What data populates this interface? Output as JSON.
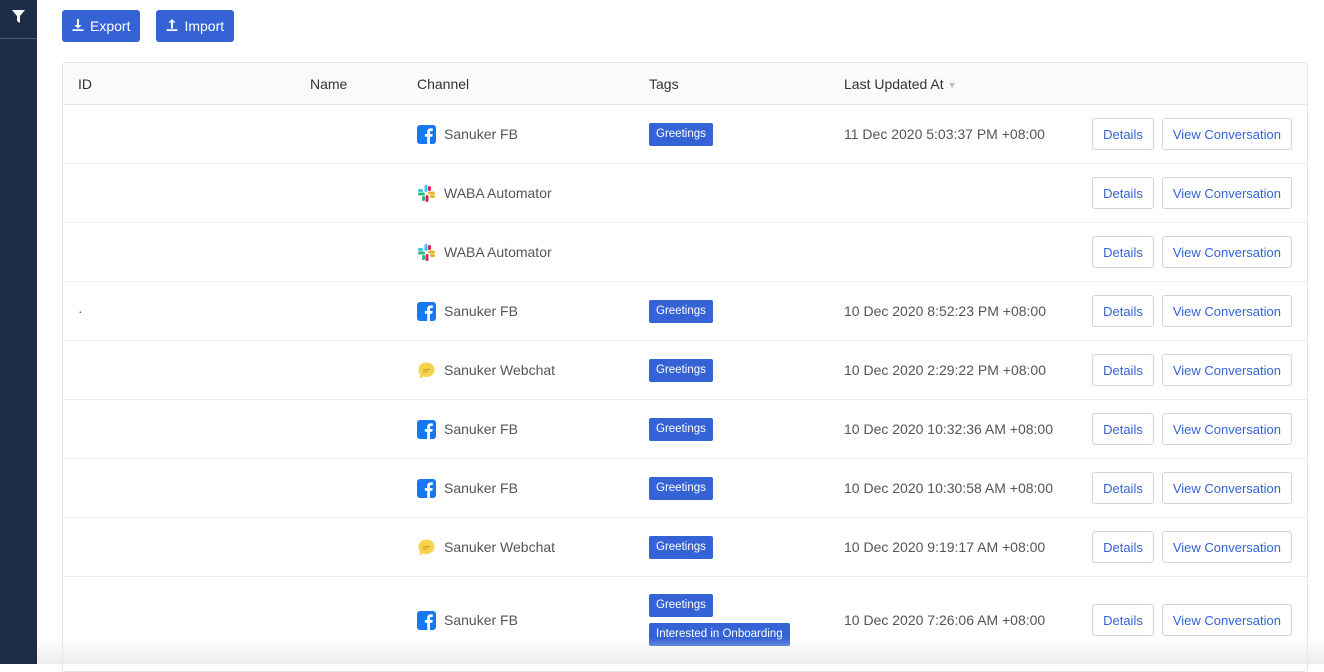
{
  "toolbar": {
    "export_label": "Export",
    "import_label": "Import"
  },
  "table": {
    "columns": {
      "id": "ID",
      "name": "Name",
      "channel": "Channel",
      "tags": "Tags",
      "updated": "Last Updated At"
    },
    "rows": [
      {
        "id": "",
        "name": "",
        "channel": "Sanuker FB",
        "channel_icon": "facebook-icon",
        "tags": [
          "Greetings"
        ],
        "updated": "11 Dec 2020 5:03:37 PM +08:00"
      },
      {
        "id": "",
        "name": "",
        "channel": "WABA Automator",
        "channel_icon": "slack-icon",
        "tags": [],
        "updated": ""
      },
      {
        "id": "",
        "name": "",
        "channel": "WABA Automator",
        "channel_icon": "slack-icon",
        "tags": [],
        "updated": ""
      },
      {
        "id": "·",
        "name": "",
        "channel": "Sanuker FB",
        "channel_icon": "facebook-icon",
        "tags": [
          "Greetings"
        ],
        "updated": "10 Dec 2020 8:52:23 PM +08:00"
      },
      {
        "id": "",
        "name": "",
        "channel": "Sanuker Webchat",
        "channel_icon": "webchat-icon",
        "tags": [
          "Greetings"
        ],
        "updated": "10 Dec 2020 2:29:22 PM +08:00"
      },
      {
        "id": "",
        "name": "",
        "channel": "Sanuker FB",
        "channel_icon": "facebook-icon",
        "tags": [
          "Greetings"
        ],
        "updated": "10 Dec 2020 10:32:36 AM +08:00"
      },
      {
        "id": "",
        "name": "",
        "channel": "Sanuker FB",
        "channel_icon": "facebook-icon",
        "tags": [
          "Greetings"
        ],
        "updated": "10 Dec 2020 10:30:58 AM +08:00"
      },
      {
        "id": "",
        "name": "",
        "channel": "Sanuker Webchat",
        "channel_icon": "webchat-icon",
        "tags": [
          "Greetings"
        ],
        "updated": "10 Dec 2020 9:19:17 AM +08:00"
      },
      {
        "id": "",
        "name": "",
        "channel": "Sanuker FB",
        "channel_icon": "facebook-icon",
        "tags": [
          "Greetings",
          "Interested in Onboarding"
        ],
        "updated": "10 Dec 2020 7:26:06 AM +08:00"
      }
    ],
    "details_label": "Details",
    "view_label": "View Conversation"
  },
  "colors": {
    "sidebar": "#1e2d47",
    "primary": "#3563d5",
    "facebook": "#1877f2",
    "webchat": "#f7d24b"
  }
}
